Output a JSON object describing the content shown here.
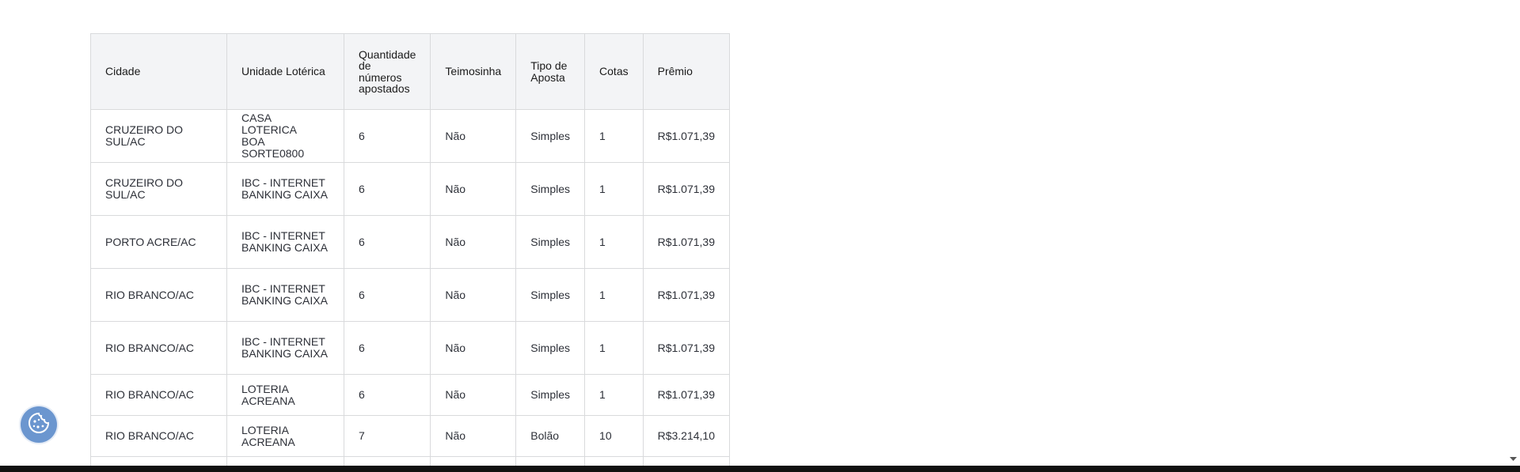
{
  "table": {
    "headers": {
      "cidade": "Cidade",
      "unidade": "Unidade Lotérica",
      "quantidade_1": "Quantidade",
      "quantidade_2": "de",
      "quantidade_3": "números",
      "quantidade_4": "apostados",
      "teimosinha": "Teimosinha",
      "tipo_1": "Tipo de",
      "tipo_2": "Aposta",
      "cotas": "Cotas",
      "premio": "Prêmio"
    },
    "rows": [
      {
        "cidade": "CRUZEIRO DO SUL/AC",
        "unidade_1": "CASA LOTERICA",
        "unidade_2": "BOA SORTE0800",
        "quantidade": "6",
        "teimosinha": "Não",
        "tipo": "Simples",
        "cotas": "1",
        "premio": "R$1.071,39"
      },
      {
        "cidade": "CRUZEIRO DO SUL/AC",
        "unidade_1": "IBC - INTERNET",
        "unidade_2": "BANKING CAIXA",
        "quantidade": "6",
        "teimosinha": "Não",
        "tipo": "Simples",
        "cotas": "1",
        "premio": "R$1.071,39"
      },
      {
        "cidade": "PORTO ACRE/AC",
        "unidade_1": "IBC - INTERNET",
        "unidade_2": "BANKING CAIXA",
        "quantidade": "6",
        "teimosinha": "Não",
        "tipo": "Simples",
        "cotas": "1",
        "premio": "R$1.071,39"
      },
      {
        "cidade": "RIO BRANCO/AC",
        "unidade_1": "IBC - INTERNET",
        "unidade_2": "BANKING CAIXA",
        "quantidade": "6",
        "teimosinha": "Não",
        "tipo": "Simples",
        "cotas": "1",
        "premio": "R$1.071,39"
      },
      {
        "cidade": "RIO BRANCO/AC",
        "unidade_1": "IBC - INTERNET",
        "unidade_2": "BANKING CAIXA",
        "quantidade": "6",
        "teimosinha": "Não",
        "tipo": "Simples",
        "cotas": "1",
        "premio": "R$1.071,39"
      },
      {
        "cidade": "RIO BRANCO/AC",
        "unidade_1": "LOTERIA ACREANA",
        "unidade_2": "",
        "quantidade": "6",
        "teimosinha": "Não",
        "tipo": "Simples",
        "cotas": "1",
        "premio": "R$1.071,39"
      },
      {
        "cidade": "RIO BRANCO/AC",
        "unidade_1": "LOTERIA ACREANA",
        "unidade_2": "",
        "quantidade": "7",
        "teimosinha": "Não",
        "tipo": "Bolão",
        "cotas": "10",
        "premio": "R$3.214,10"
      }
    ]
  },
  "icons": {
    "cookie": "cookie-icon",
    "scroll_down": "chevron-down-icon"
  },
  "colors": {
    "header_bg": "#f3f4f6",
    "border": "#d9dadc",
    "cookie_button": "#6b96cf",
    "heading": "#1d5ec7"
  }
}
